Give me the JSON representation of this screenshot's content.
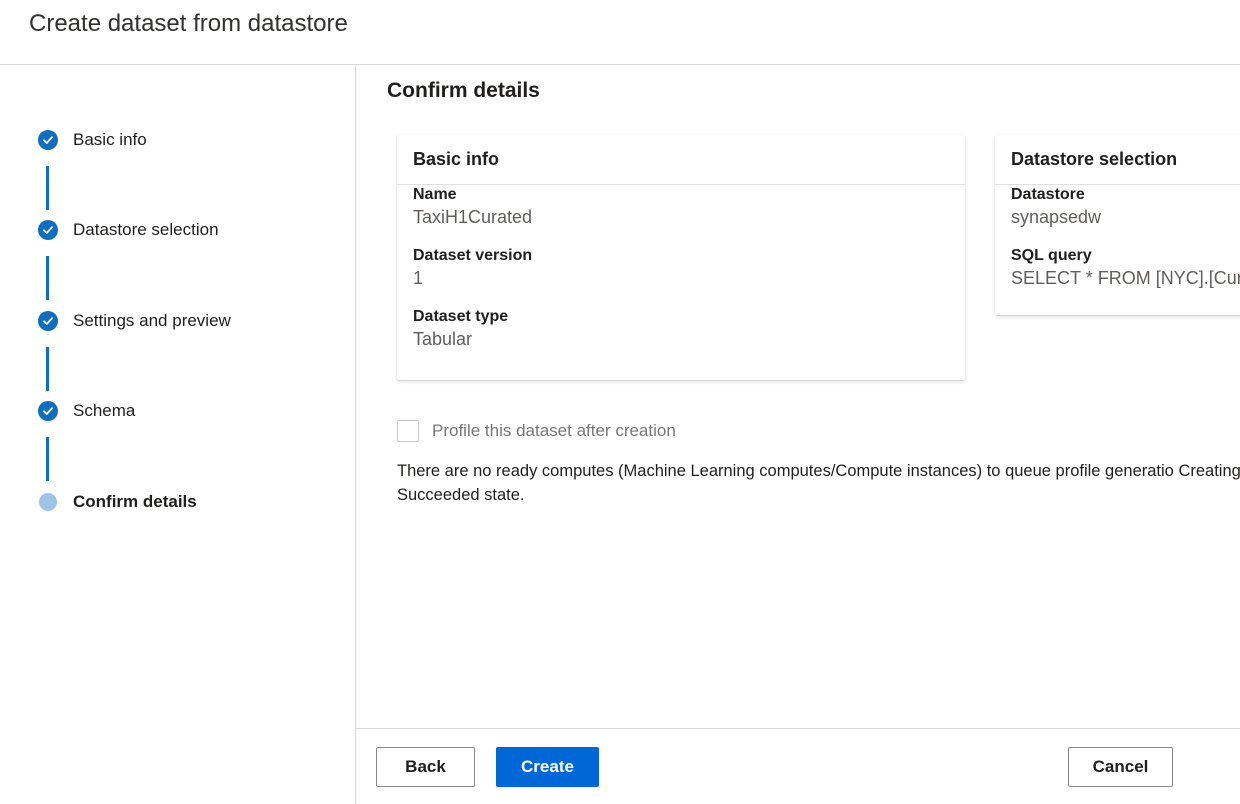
{
  "dialog": {
    "title": "Create dataset from datastore"
  },
  "stepper": {
    "steps": [
      {
        "label": "Basic info",
        "status": "completed"
      },
      {
        "label": "Datastore selection",
        "status": "completed"
      },
      {
        "label": "Settings and preview",
        "status": "completed"
      },
      {
        "label": "Schema",
        "status": "completed"
      },
      {
        "label": "Confirm details",
        "status": "current"
      }
    ]
  },
  "main": {
    "title": "Confirm details",
    "basic_info": {
      "heading": "Basic info",
      "fields": [
        {
          "label": "Name",
          "value": "TaxiH1Curated"
        },
        {
          "label": "Dataset version",
          "value": "1"
        },
        {
          "label": "Dataset type",
          "value": "Tabular"
        }
      ]
    },
    "datastore_selection": {
      "heading": "Datastore selection",
      "fields": [
        {
          "label": "Datastore",
          "value": "synapsedw"
        },
        {
          "label": "SQL query",
          "value": "SELECT * FROM [NYC].[Cur"
        }
      ]
    },
    "profile": {
      "checkbox_label": "Profile this dataset after creation",
      "checked": false
    },
    "notice": "There are no ready computes (Machine Learning computes/Compute instances) to queue profile generatio Creating, or Succeeded state."
  },
  "footer": {
    "back_label": "Back",
    "create_label": "Create",
    "cancel_label": "Cancel"
  },
  "colors": {
    "accent": "#106ebe",
    "primary_button": "#0068d6",
    "current_step": "#9ec3e6"
  },
  "icons": {
    "completed_step": "checkmark-circle-icon",
    "current_step": "circle-icon"
  }
}
